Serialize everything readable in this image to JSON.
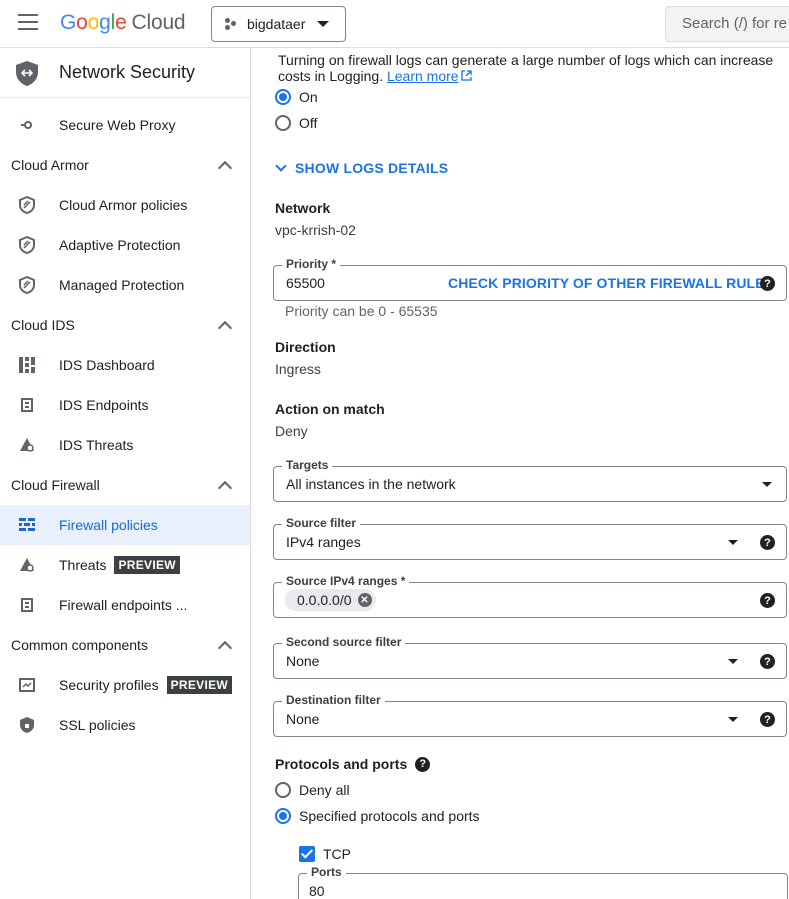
{
  "topbar": {
    "logo_letters": [
      "G",
      "o",
      "o",
      "g",
      "l",
      "e"
    ],
    "logo_suffix": "Cloud",
    "project_name": "bigdataer",
    "search_placeholder": "Search (/) for re"
  },
  "sidebar": {
    "title": "Network Security",
    "top_item": {
      "label": "Secure Web Proxy",
      "icon": "proxy-icon"
    },
    "sections": [
      {
        "title": "Cloud Armor",
        "items": [
          {
            "label": "Cloud Armor policies",
            "icon": "shield-icon"
          },
          {
            "label": "Adaptive Protection",
            "icon": "shield-icon"
          },
          {
            "label": "Managed Protection",
            "icon": "shield-icon"
          }
        ]
      },
      {
        "title": "Cloud IDS",
        "items": [
          {
            "label": "IDS Dashboard",
            "icon": "dashboard-icon"
          },
          {
            "label": "IDS Endpoints",
            "icon": "endpoint-icon"
          },
          {
            "label": "IDS Threats",
            "icon": "threat-icon"
          }
        ]
      },
      {
        "title": "Cloud Firewall",
        "items": [
          {
            "label": "Firewall policies",
            "icon": "firewall-icon",
            "active": true
          },
          {
            "label": "Threats",
            "icon": "threat-icon",
            "badge": "PREVIEW"
          },
          {
            "label": "Firewall endpoints ...",
            "icon": "endpoint-icon"
          }
        ]
      },
      {
        "title": "Common components",
        "items": [
          {
            "label": "Security profiles",
            "icon": "profile-icon",
            "badge": "PREVIEW"
          },
          {
            "label": "SSL policies",
            "icon": "ssl-shield-icon"
          }
        ]
      }
    ]
  },
  "main": {
    "logs_info": "Turning on firewall logs can generate a large number of logs which can increase costs in Logging.",
    "learn_more": "Learn more",
    "logs_on": "On",
    "logs_off": "Off",
    "show_logs_details": "SHOW LOGS DETAILS",
    "network_label": "Network",
    "network_value": "vpc-krrish-02",
    "priority_label": "Priority *",
    "priority_value": "65500",
    "priority_link": "CHECK PRIORITY OF OTHER FIREWALL RULES",
    "priority_hint": "Priority can be 0 - 65535",
    "direction_label": "Direction",
    "direction_value": "Ingress",
    "action_label": "Action on match",
    "action_value": "Deny",
    "targets_label": "Targets",
    "targets_value": "All instances in the network",
    "source_filter_label": "Source filter",
    "source_filter_value": "IPv4 ranges",
    "source_ranges_label": "Source IPv4 ranges *",
    "source_range_chip": "0.0.0.0/0",
    "second_source_label": "Second source filter",
    "second_source_value": "None",
    "dest_filter_label": "Destination filter",
    "dest_filter_value": "None",
    "protocols_label": "Protocols and ports",
    "deny_all": "Deny all",
    "specified": "Specified protocols and ports",
    "tcp_label": "TCP",
    "ports_label": "Ports",
    "ports_value": "80",
    "help_glyph": "?"
  }
}
